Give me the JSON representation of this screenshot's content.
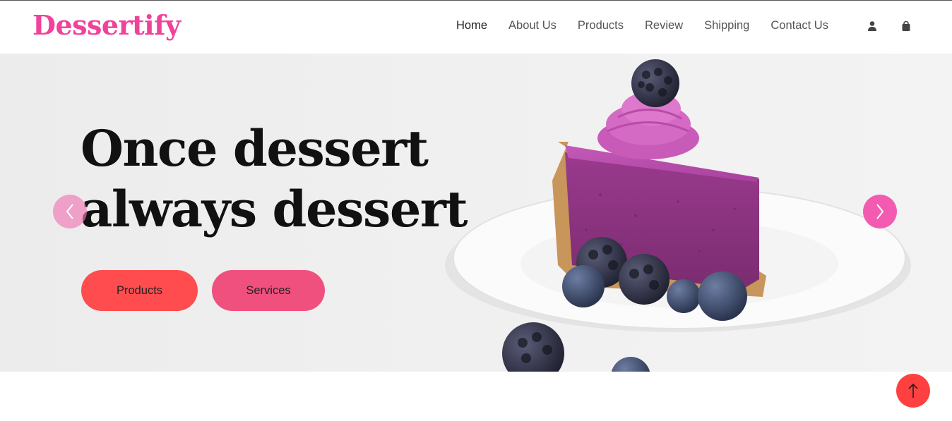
{
  "brand": {
    "name": "Dessertify",
    "color": "#f0429a"
  },
  "nav": {
    "items": [
      {
        "label": "Home",
        "active": true
      },
      {
        "label": "About Us"
      },
      {
        "label": "Products"
      },
      {
        "label": "Review"
      },
      {
        "label": "Shipping"
      },
      {
        "label": "Contact Us"
      }
    ],
    "icons": [
      "user-icon",
      "shopping-bag-icon"
    ]
  },
  "hero": {
    "headline_line1": "Once dessert",
    "headline_line2": "always dessert",
    "buttons": {
      "products_label": "Products",
      "services_label": "Services"
    },
    "colors": {
      "products": "#ff4d4f",
      "services": "#ef507e",
      "next_arrow": "#f25bb0"
    },
    "image": "purple berry cheesecake slice on plate"
  },
  "back_to_top": {
    "icon": "arrow-up-icon",
    "color": "#ff4040"
  }
}
